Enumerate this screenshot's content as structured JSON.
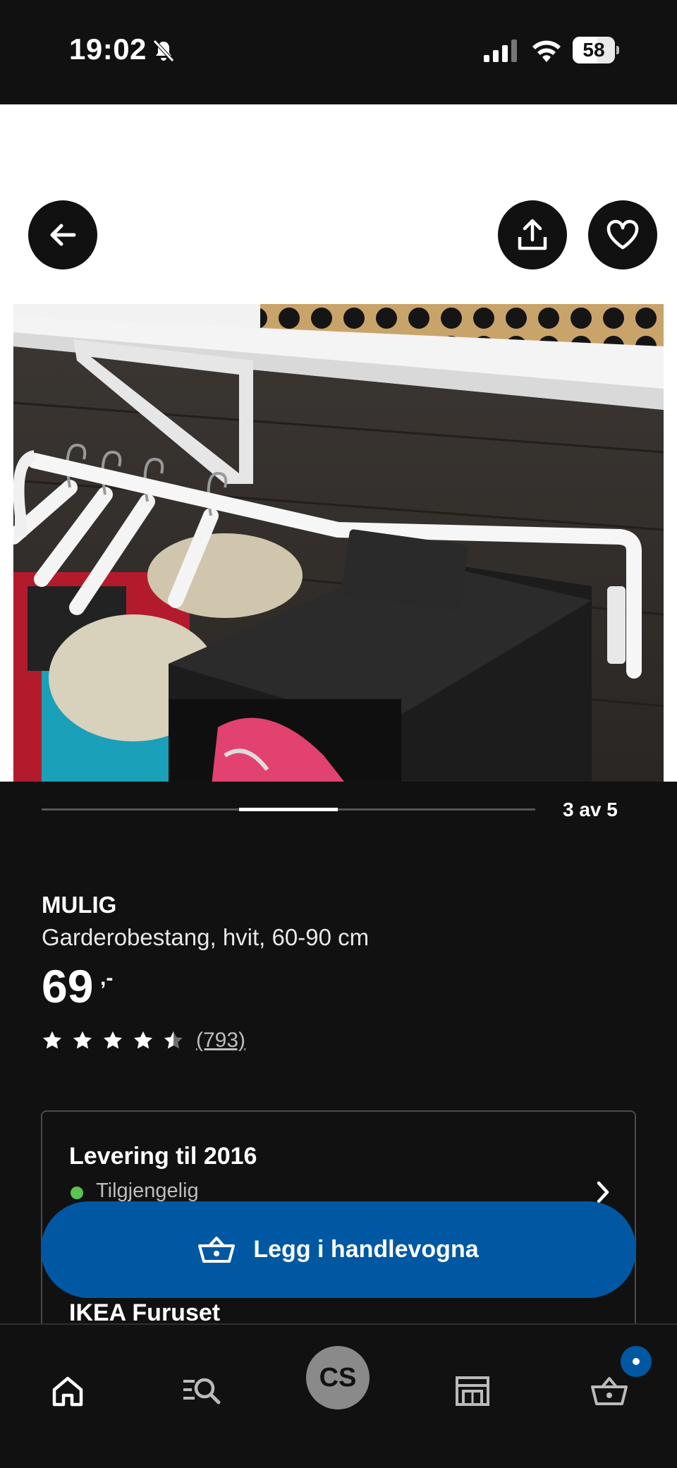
{
  "status_bar": {
    "time": "19:02",
    "battery": "58",
    "battery_fraction": 0.58
  },
  "gallery": {
    "counter": "3 av 5",
    "current_index": 3,
    "total": 5
  },
  "product": {
    "name": "MULIG",
    "description": "Garderobestang, hvit, 60-90 cm",
    "price": "69",
    "price_suffix": ",-",
    "rating": 4.5,
    "review_count": "(793)"
  },
  "delivery": {
    "title": "Levering til 2016",
    "availability": "Tilgjengelig",
    "availability_color": "#59c44f",
    "store_title": "IKEA Furuset"
  },
  "actions": {
    "add_to_cart": "Legg i handlevogna"
  },
  "nav": {
    "profile_initials": "CS",
    "items": [
      "home-icon",
      "search-icon",
      "profile-avatar",
      "store-icon",
      "cart-icon"
    ]
  },
  "colors": {
    "accent": "#0058a3",
    "background": "#111111",
    "available": "#59c44f"
  }
}
